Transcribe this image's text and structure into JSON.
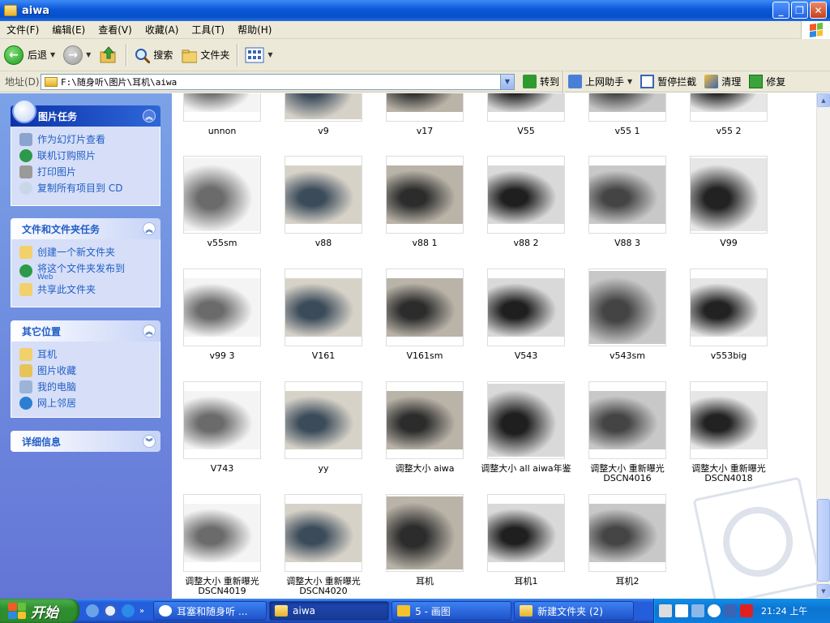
{
  "window": {
    "title": "aiwa",
    "min": "_",
    "max": "❐",
    "close": "✕"
  },
  "menu": [
    "文件(F)",
    "编辑(E)",
    "查看(V)",
    "收藏(A)",
    "工具(T)",
    "帮助(H)"
  ],
  "toolbar": {
    "back": "后退",
    "search": "搜索",
    "folders": "文件夹"
  },
  "address": {
    "label": "地址(D)",
    "path": "F:\\随身听\\图片\\耳机\\aiwa",
    "go": "转到",
    "assistant": "上网助手",
    "popup_block": "暂停拦截",
    "clean": "清理",
    "repair": "修复"
  },
  "sidebar": {
    "tasks": {
      "title": "图片任务",
      "items": [
        "作为幻灯片查看",
        "联机订购照片",
        "打印图片",
        "复制所有项目到 CD"
      ]
    },
    "file_tasks": {
      "title": "文件和文件夹任务",
      "items": [
        "创建一个新文件夹",
        "将这个文件夹发布到",
        "共享此文件夹"
      ],
      "publish_sub": "Web"
    },
    "other_places": {
      "title": "其它位置",
      "items": [
        "耳机",
        "图片收藏",
        "我的电脑",
        "网上邻居"
      ]
    },
    "details": {
      "title": "详细信息"
    }
  },
  "files": [
    {
      "name": "unnon"
    },
    {
      "name": "v9"
    },
    {
      "name": "v17"
    },
    {
      "name": "V55"
    },
    {
      "name": "v55 1"
    },
    {
      "name": "v55 2"
    },
    {
      "name": "v55sm"
    },
    {
      "name": "v88"
    },
    {
      "name": "v88 1"
    },
    {
      "name": "v88 2"
    },
    {
      "name": "V88 3"
    },
    {
      "name": "V99"
    },
    {
      "name": "v99 3"
    },
    {
      "name": "V161"
    },
    {
      "name": "V161sm"
    },
    {
      "name": "V543"
    },
    {
      "name": "v543sm"
    },
    {
      "name": "v553big"
    },
    {
      "name": "V743"
    },
    {
      "name": "yy"
    },
    {
      "name": "调整大小 aiwa"
    },
    {
      "name": "调整大小 all aiwa年鉴"
    },
    {
      "name": "调整大小 重新曝光DSCN4016"
    },
    {
      "name": "调整大小 重新曝光DSCN4018"
    },
    {
      "name": "调整大小 重新曝光DSCN4019"
    },
    {
      "name": "调整大小 重新曝光DSCN4020"
    },
    {
      "name": "耳机"
    },
    {
      "name": "耳机1"
    },
    {
      "name": "耳机2"
    }
  ],
  "taskbar": {
    "start": "开始",
    "tasks": [
      {
        "label": "耳塞和随身听 ..."
      },
      {
        "label": "aiwa"
      },
      {
        "label": "5 - 画图"
      },
      {
        "label": "新建文件夹 (2)"
      }
    ],
    "clock": "21:24 上午"
  }
}
